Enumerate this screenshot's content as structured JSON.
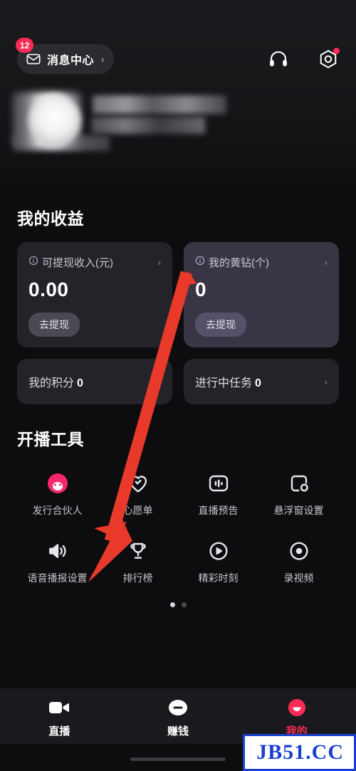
{
  "header": {
    "message_center": {
      "label": "消息中心",
      "badge": "12",
      "icon": "envelope-icon",
      "chevron": "›"
    },
    "headset_icon": "headset-icon",
    "settings_icon": "settings-gear-icon"
  },
  "profile": {
    "blurred": true
  },
  "earnings": {
    "title": "我的收益",
    "cards": [
      {
        "label": "可提现收入(元)",
        "value": "0.00",
        "button": "去提现",
        "info_icon": "info-icon",
        "chevron": "›"
      },
      {
        "label": "我的黄钻(个)",
        "value": "0",
        "button": "去提现",
        "info_icon": "info-icon",
        "chevron": "›"
      }
    ],
    "rows": [
      {
        "label": "我的积分",
        "value": "0",
        "chevron": "›"
      },
      {
        "label": "进行中任务",
        "value": "0",
        "chevron": "›"
      }
    ]
  },
  "tools": {
    "title": "开播工具",
    "items": [
      {
        "label": "发行合伙人",
        "icon": "partner-avatar-icon"
      },
      {
        "label": "心愿单",
        "icon": "heart-icon"
      },
      {
        "label": "直播预告",
        "icon": "broadcast-preview-icon"
      },
      {
        "label": "悬浮窗设置",
        "icon": "floating-window-icon"
      },
      {
        "label": "语音播报设置",
        "icon": "speaker-icon"
      },
      {
        "label": "排行榜",
        "icon": "trophy-icon"
      },
      {
        "label": "精彩时刻",
        "icon": "play-circle-icon"
      },
      {
        "label": "录视频",
        "icon": "record-circle-icon"
      }
    ],
    "page_dots": {
      "count": 2,
      "active_index": 0
    }
  },
  "tabbar": {
    "items": [
      {
        "label": "直播",
        "icon": "live-camera-icon",
        "active": false
      },
      {
        "label": "赚钱",
        "icon": "coin-icon",
        "active": false
      },
      {
        "label": "我的",
        "icon": "profile-smile-icon",
        "active": true
      }
    ]
  },
  "annotation": {
    "arrow_color": "#e8392a"
  },
  "watermark": {
    "text": "JB51.CC",
    "text_color": "#1a3fd0",
    "border_color": "#1a3fd0"
  }
}
